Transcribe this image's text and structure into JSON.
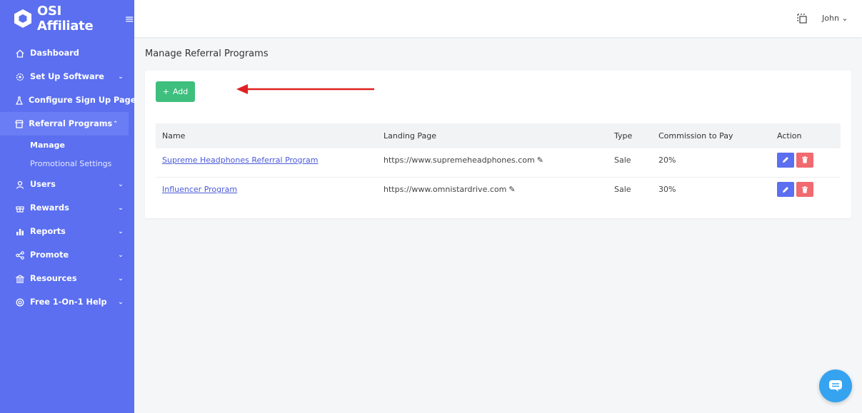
{
  "brand": {
    "name": "OSI Affiliate"
  },
  "sidebar": {
    "items": [
      {
        "label": "Dashboard",
        "icon": "home-icon",
        "chevron": ""
      },
      {
        "label": "Set Up Software",
        "icon": "gear-icon",
        "chevron": "⌄"
      },
      {
        "label": "Configure Sign Up Page",
        "icon": "flask-icon",
        "chevron": ""
      },
      {
        "label": "Referral Programs",
        "icon": "store-icon",
        "chevron": "⌃",
        "active": true
      },
      {
        "label": "Users",
        "icon": "user-icon",
        "chevron": "⌄"
      },
      {
        "label": "Rewards",
        "icon": "gift-icon",
        "chevron": "⌄"
      },
      {
        "label": "Reports",
        "icon": "bar-chart-icon",
        "chevron": "⌄"
      },
      {
        "label": "Promote",
        "icon": "share-icon",
        "chevron": "⌄"
      },
      {
        "label": "Resources",
        "icon": "bank-icon",
        "chevron": "⌄"
      },
      {
        "label": "Free 1-On-1 Help",
        "icon": "lifebuoy-icon",
        "chevron": "⌄"
      }
    ],
    "subitems": [
      {
        "label": "Manage",
        "active": true
      },
      {
        "label": "Promotional Settings"
      }
    ]
  },
  "topbar": {
    "user": "John ⌄"
  },
  "page": {
    "title": "Manage Referral Programs"
  },
  "toolbar": {
    "add_label": "Add"
  },
  "table": {
    "headers": [
      "Name",
      "Landing Page",
      "Type",
      "Commission to Pay",
      "Action"
    ],
    "rows": [
      {
        "name": "Supreme Headphones Referral Program",
        "landing": "https://www.supremeheadphones.com",
        "type": "Sale",
        "commission": "20%"
      },
      {
        "name": "Influencer Program",
        "landing": "https://www.omnistardrive.com",
        "type": "Sale",
        "commission": "30%"
      }
    ]
  },
  "colors": {
    "sidebar": "#5b6ff0",
    "add_button": "#3ebf7e",
    "edit_button": "#5b6ff0",
    "delete_button": "#f06a6f",
    "annotation_arrow": "#e02020",
    "chat": "#35a3f0"
  }
}
